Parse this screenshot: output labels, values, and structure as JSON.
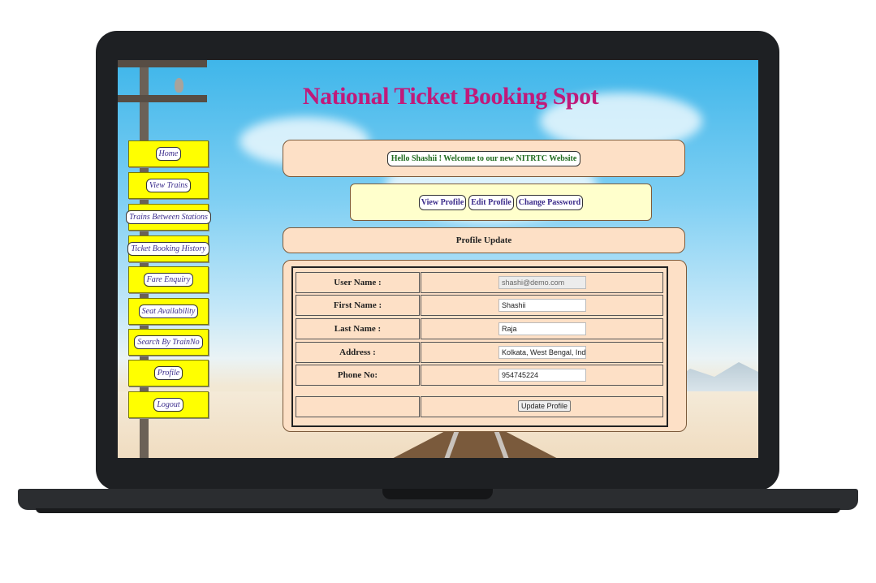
{
  "site": {
    "title": "National Ticket Booking Spot"
  },
  "nav": {
    "items": [
      {
        "label": "Home"
      },
      {
        "label": "View Trains"
      },
      {
        "label": "Trains Between Stations"
      },
      {
        "label": "Ticket Booking History"
      },
      {
        "label": "Fare Enquiry"
      },
      {
        "label": "Seat Availability"
      },
      {
        "label": "Search By TrainNo"
      },
      {
        "label": "Profile"
      },
      {
        "label": "Logout"
      }
    ]
  },
  "welcome": {
    "text": "Hello Shashii ! Welcome to our new NITRTC Website"
  },
  "profile_menu": {
    "view_profile": "View Profile",
    "edit_profile": "Edit Profile",
    "change_password": "Change Password"
  },
  "section": {
    "title": "Profile Update"
  },
  "form": {
    "username": {
      "label": "User Name :",
      "value": "shashi@demo.com"
    },
    "first_name": {
      "label": "First Name :",
      "value": "Shashii"
    },
    "last_name": {
      "label": "Last Name :",
      "value": "Raja"
    },
    "address": {
      "label": "Address :",
      "value": "Kolkata, West Bengal, India"
    },
    "phone": {
      "label": "Phone No:",
      "value": "954745224"
    },
    "submit_label": "Update Profile"
  },
  "colors": {
    "title": "#c01a7a",
    "nav_bg": "#ffff00",
    "panel_bg": "#fde0c6",
    "menu_bg": "#ffffcc",
    "welcome_text": "#1d6a1d"
  }
}
